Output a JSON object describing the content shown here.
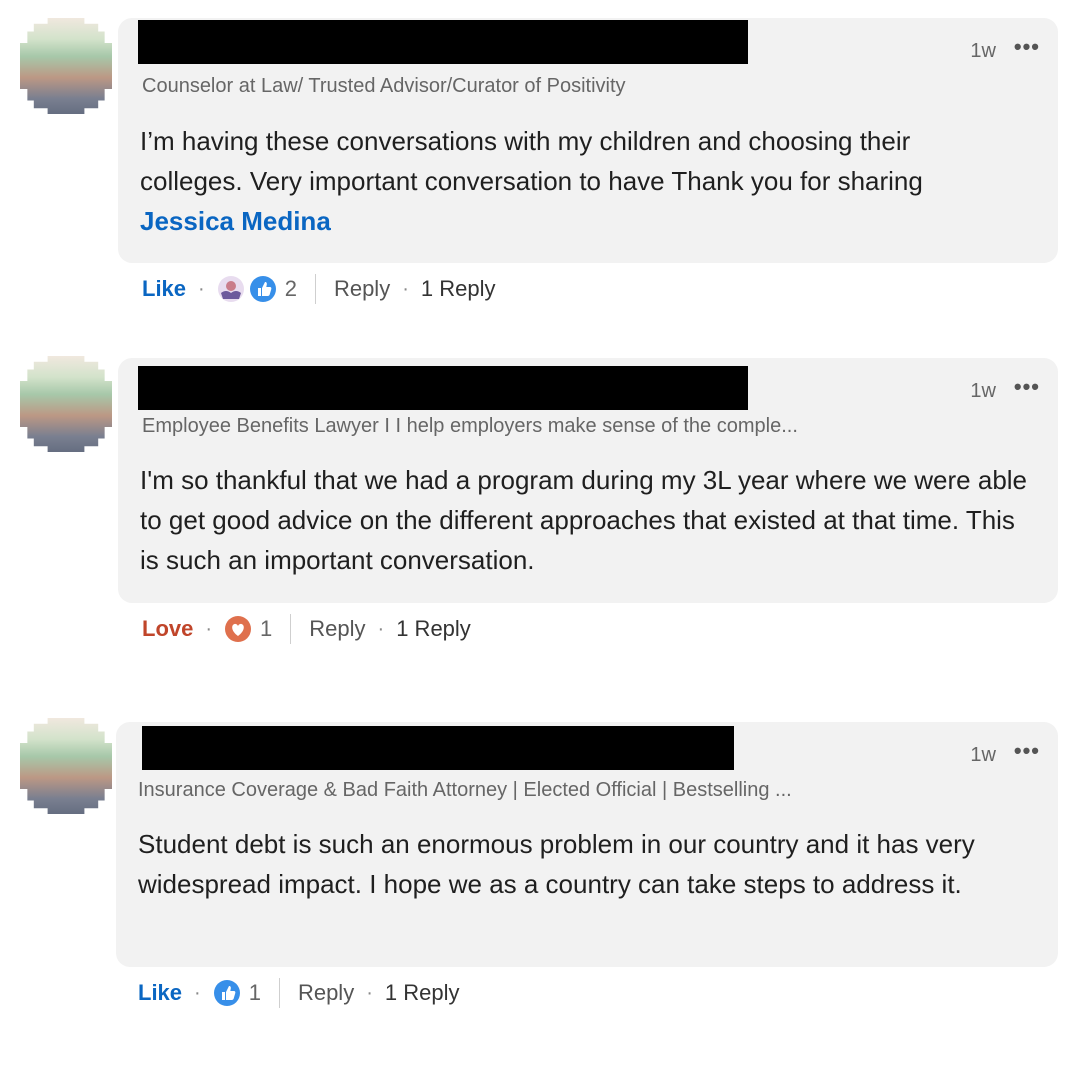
{
  "comments": [
    {
      "time": "1w",
      "more": "•••",
      "headline": "Counselor at Law/ Trusted Advisor/Curator of Positivity",
      "text_part1": "I’m having these conversations with my children and choosing their colleges. Very important conversation to have Thank you for sharing ",
      "mention": "Jessica Medina",
      "reaction_label": "Like",
      "reaction_count": "2",
      "reply_label": "Reply",
      "replies": "1 Reply",
      "reaction_icons": [
        "support-icon",
        "like-icon"
      ]
    },
    {
      "time": "1w",
      "more": "•••",
      "headline": "Employee Benefits Lawyer I I help employers make sense of the comple...",
      "text": "I'm so thankful that we had a program during my 3L year where we were able to get good advice on the different approaches that existed at that time. This is such an important conversation.",
      "reaction_label": "Love",
      "reaction_count": "1",
      "reply_label": "Reply",
      "replies": "1 Reply",
      "reaction_icons": [
        "love-icon"
      ]
    },
    {
      "time": "1w",
      "more": "•••",
      "headline": "Insurance Coverage & Bad Faith Attorney | Elected Official | Bestselling ...",
      "text": "Student debt is such an enormous problem in our country and it has very widespread impact. I hope we as a country can take steps to address it.",
      "reaction_label": "Like",
      "reaction_count": "1",
      "reply_label": "Reply",
      "replies": "1 Reply",
      "reaction_icons": [
        "like-icon"
      ]
    }
  ],
  "colors": {
    "link_blue": "#0a66c2",
    "love_red": "#c0452a",
    "bubble_bg": "#f2f2f2"
  }
}
